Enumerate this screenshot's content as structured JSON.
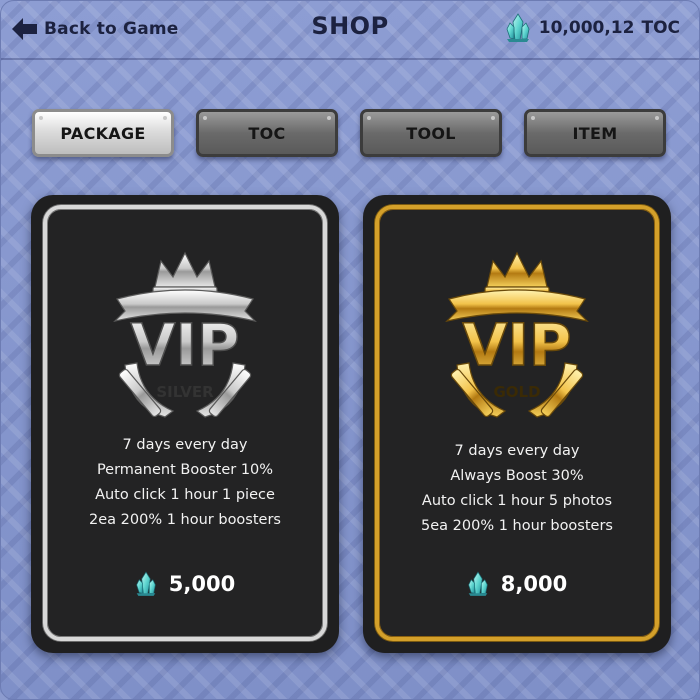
{
  "header": {
    "back_label": "Back to Game",
    "title": "SHOP",
    "balance_amount": "10,000,12",
    "balance_unit": "TOC"
  },
  "tabs": [
    {
      "label": "PACKAGE",
      "active": true
    },
    {
      "label": "TOC",
      "active": false
    },
    {
      "label": "TOOL",
      "active": false
    },
    {
      "label": "ITEM",
      "active": false
    }
  ],
  "cards": [
    {
      "tier": "silver",
      "emblem_text": "VIP",
      "emblem_subtitle": "SILVER",
      "features": [
        "7 days every day",
        "Permanent Booster 10%",
        "Auto click 1 hour 1 piece",
        "2ea 200% 1 hour boosters"
      ],
      "price": "5,000"
    },
    {
      "tier": "gold",
      "emblem_text": "VIP",
      "emblem_subtitle": "GOLD",
      "features": [
        "7 days every day",
        "Always Boost 30%",
        "Auto click 1 hour 5 photos",
        "5ea 200% 1 hour boosters"
      ],
      "price": "8,000"
    }
  ],
  "colors": {
    "background": "#8a9ad0",
    "card": "#1f1f20",
    "silver": "#d8d8d8",
    "gold": "#d4a02a",
    "crystal": "#5fd6d0"
  },
  "icons": {
    "back": "arrow-left-icon",
    "currency": "crystal-icon",
    "emblem_silver": "vip-silver-emblem-icon",
    "emblem_gold": "vip-gold-emblem-icon"
  }
}
